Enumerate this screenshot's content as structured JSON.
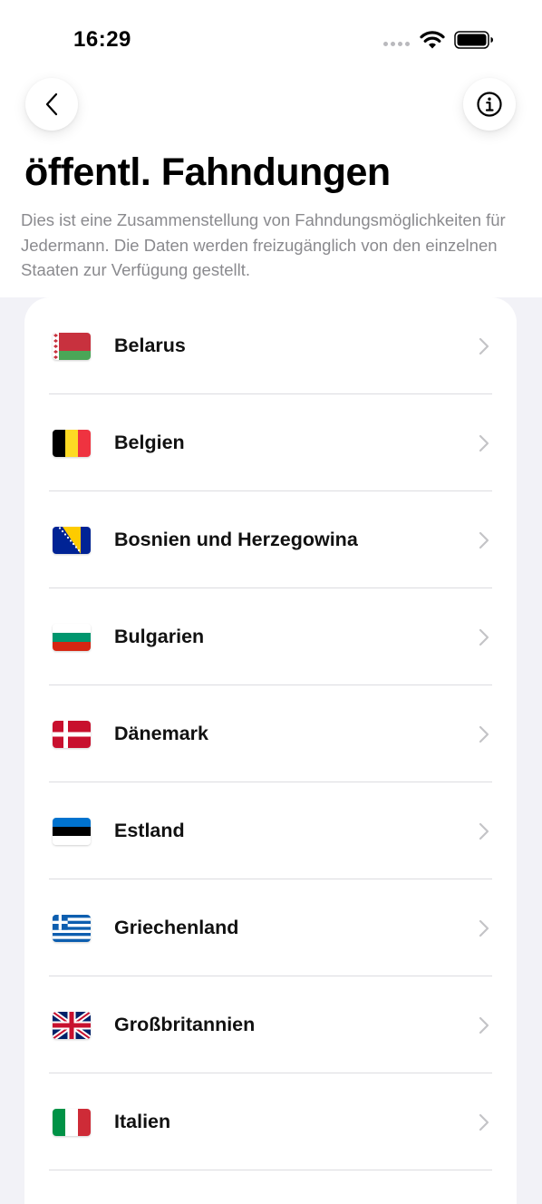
{
  "status_bar": {
    "time": "16:29"
  },
  "nav": {
    "back_icon": "chevron-left-icon",
    "info_icon": "info-circle-icon"
  },
  "page": {
    "title": "öffentl. Fahndungen",
    "description": "Dies ist eine Zusammenstellung von Fahndungsmöglichkei­ten für Jedermann. Die Daten werden freizugänglich von den einzelnen Staaten zur Verfügung gestellt."
  },
  "countries": [
    {
      "label": "Belarus",
      "flag": "flag-belarus-icon"
    },
    {
      "label": "Belgien",
      "flag": "flag-belgium-icon"
    },
    {
      "label": "Bosnien und Herzegowina",
      "flag": "flag-bosnia-icon"
    },
    {
      "label": "Bulgarien",
      "flag": "flag-bulgaria-icon"
    },
    {
      "label": "Dänemark",
      "flag": "flag-denmark-icon"
    },
    {
      "label": "Estland",
      "flag": "flag-estonia-icon"
    },
    {
      "label": "Griechenland",
      "flag": "flag-greece-icon"
    },
    {
      "label": "Großbritannien",
      "flag": "flag-uk-icon"
    },
    {
      "label": "Italien",
      "flag": "flag-italy-icon"
    }
  ],
  "colors": {
    "background": "#f2f2f7",
    "card": "#ffffff",
    "secondary_text": "#8a8a8e",
    "separator": "#dcdce0",
    "chevron": "#c4c4c7"
  }
}
